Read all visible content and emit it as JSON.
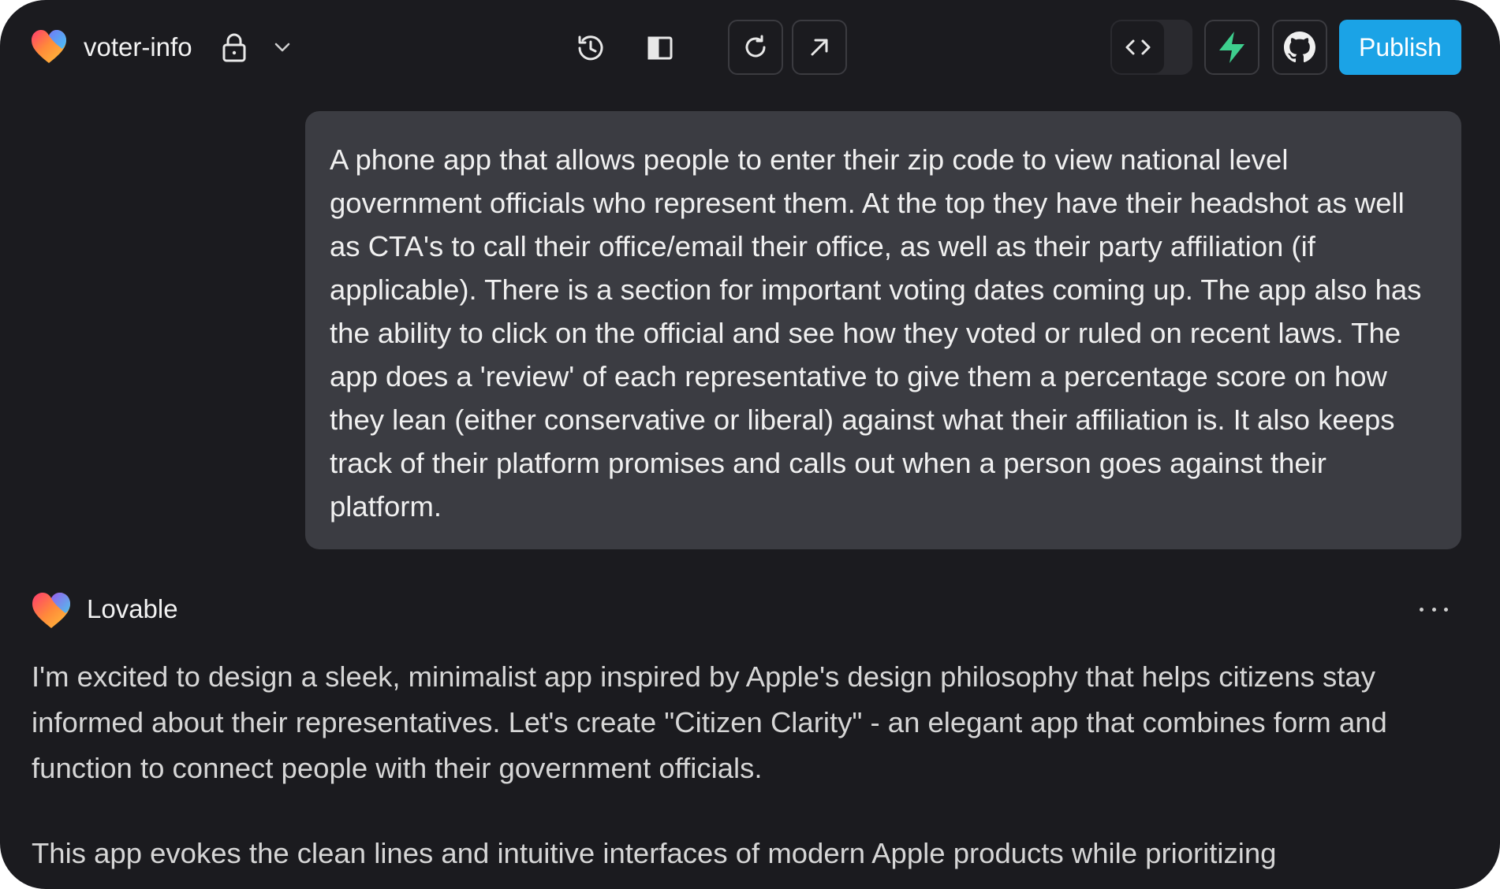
{
  "topbar": {
    "project_name": "voter-info",
    "publish_label": "Publish",
    "icons": [
      "lovable-heart-icon",
      "lock-icon",
      "chevron-down-icon",
      "history-icon",
      "sidebar-toggle-icon",
      "refresh-icon",
      "open-external-icon",
      "code-icon",
      "bolt-icon",
      "github-icon"
    ]
  },
  "user_message": {
    "text": "A phone app that allows people to enter their zip code to view national level government officials who represent them. At the top they have their headshot as well as CTA's to call their office/email their office, as well as their party affiliation (if applicable). There is a section for important voting dates coming up. The app also has the ability to click on the official and see how they voted or ruled on recent laws. The app does a 'review' of each representative to give them a percentage score on how they lean (either conservative or liberal) against what their affiliation is. It also keeps track of their platform promises and calls out when a person goes against their platform."
  },
  "assistant_message": {
    "sender": "Lovable",
    "paragraphs": [
      "I'm excited to design a sleek, minimalist app inspired by Apple's design philosophy that helps citizens stay informed about their representatives. Let's create \"Citizen Clarity\" - an elegant app that combines form and function to connect people with their government officials.",
      "This app evokes the clean lines and intuitive interfaces of modern Apple products while prioritizing"
    ]
  },
  "colors": {
    "background": "#1b1b1f",
    "bubble": "#3b3c42",
    "publish": "#1ba3e6",
    "bolt": "#3ecf8e"
  }
}
